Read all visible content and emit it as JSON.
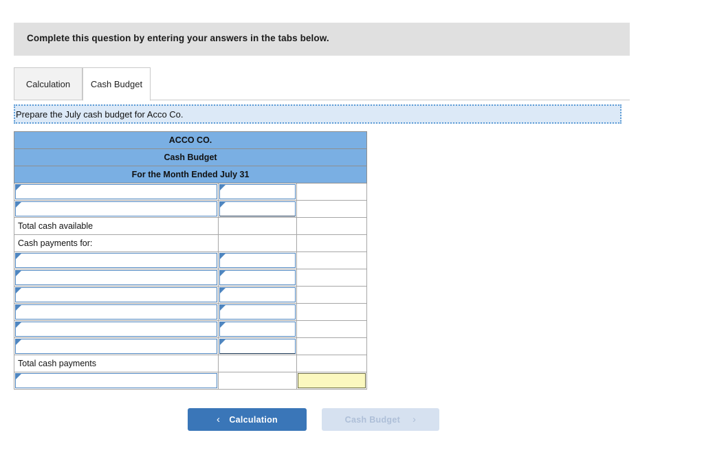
{
  "banner": {
    "text": "Complete this question by entering your answers in the tabs below."
  },
  "tabs": [
    {
      "label": "Calculation",
      "state": "inactive"
    },
    {
      "label": "Cash Budget",
      "state": "active"
    }
  ],
  "instruction": {
    "text": "Prepare the July cash budget for Acco Co."
  },
  "sheet": {
    "headers": [
      "ACCO CO.",
      "Cash Budget",
      "For the Month Ended July 31"
    ],
    "rows": [
      {
        "type": "input",
        "label": "",
        "col2": "input",
        "col3": "empty"
      },
      {
        "type": "input",
        "label": "",
        "col2": "input",
        "col3": "empty"
      },
      {
        "type": "label",
        "label": "Total cash available",
        "col2": "empty",
        "col3": "empty"
      },
      {
        "type": "label",
        "label": "Cash payments for:",
        "col2": "empty",
        "col3": "empty"
      },
      {
        "type": "input",
        "label": "",
        "col2": "input",
        "col3": "empty"
      },
      {
        "type": "input",
        "label": "",
        "col2": "input",
        "col3": "empty"
      },
      {
        "type": "input",
        "label": "",
        "col2": "input",
        "col3": "empty"
      },
      {
        "type": "input",
        "label": "",
        "col2": "input",
        "col3": "empty"
      },
      {
        "type": "input",
        "label": "",
        "col2": "input",
        "col3": "empty"
      },
      {
        "type": "input",
        "label": "",
        "col2": "input",
        "col3": "empty"
      },
      {
        "type": "label",
        "label": "Total cash payments",
        "col2": "empty",
        "col3": "empty"
      },
      {
        "type": "input",
        "label": "",
        "col2": "empty",
        "col3": "yellow"
      }
    ],
    "colors": {
      "header_blue": "#7aafe3",
      "input_border": "#4f86c0",
      "answer_yellow": "#fbf8bf",
      "grid_line": "#a6a6a6"
    }
  },
  "nav": {
    "prev": {
      "label": "Calculation",
      "icon": "chevron-left-icon",
      "glyph": "‹",
      "enabled": true
    },
    "next": {
      "label": "Cash Budget",
      "icon": "chevron-right-icon",
      "glyph": "›",
      "enabled": false
    },
    "colors": {
      "active_blue": "#3a76b8",
      "disabled_blue": "#d6e1f0"
    }
  }
}
